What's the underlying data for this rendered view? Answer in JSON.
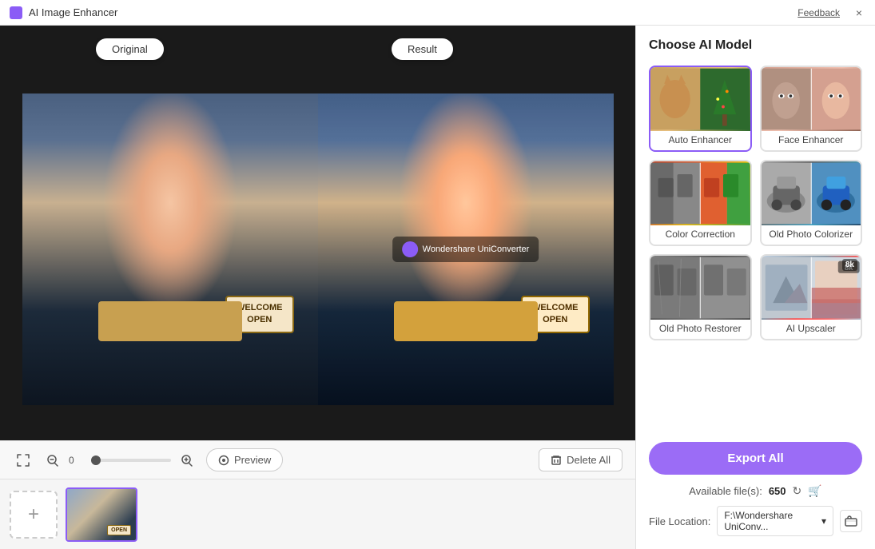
{
  "titleBar": {
    "title": "AI Image Enhancer",
    "feedback": "Feedback",
    "close": "×"
  },
  "imagePanel": {
    "originalLabel": "Original",
    "resultLabel": "Result",
    "signLine1": "WELCOME",
    "signLine2": "OPEN",
    "watermarkText": "Wondershare UniConverter"
  },
  "toolbar": {
    "zoomValue": "0",
    "previewLabel": "Preview",
    "deleteAllLabel": "Delete All"
  },
  "rightPanel": {
    "title": "Choose AI Model",
    "models": [
      {
        "id": "auto-enhancer",
        "label": "Auto Enhancer",
        "selected": true
      },
      {
        "id": "face-enhancer",
        "label": "Face Enhancer",
        "selected": false
      },
      {
        "id": "color-correction",
        "label": "Color Correction",
        "selected": false
      },
      {
        "id": "old-photo-colorizer",
        "label": "Old Photo Colorizer",
        "selected": false
      },
      {
        "id": "old-photo-restorer",
        "label": "Old Photo Restorer",
        "selected": false
      },
      {
        "id": "ai-upscaler",
        "label": "AI Upscaler",
        "selected": false
      }
    ],
    "exportLabel": "Export All",
    "availableFilesLabel": "Available file(s):",
    "availableFilesCount": "650",
    "fileLocationLabel": "File Location:",
    "fileLocationPath": "F:\\Wondershare UniConv...",
    "fileLocationDropdown": "▾"
  }
}
